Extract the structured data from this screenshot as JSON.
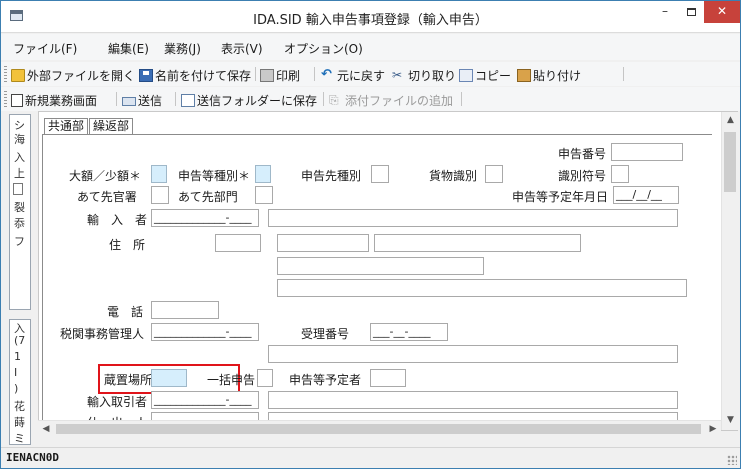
{
  "window": {
    "title": "IDA.SID 輸入申告事項登録（輸入申告）",
    "close_label": "✕",
    "minimize_label": "–"
  },
  "menu": {
    "items": [
      "ファイル(F)",
      "編集(E)",
      "業務(J)",
      "表示(V)",
      "オプション(O)"
    ]
  },
  "toolbar1": {
    "open_external": "外部ファイルを開く",
    "save_as": "名前を付けて保存",
    "print": "印刷",
    "undo": "元に戻す",
    "cut": "切り取り",
    "copy": "コピー",
    "paste": "貼り付け"
  },
  "toolbar2": {
    "new_screen": "新規業務画面",
    "send": "送信",
    "save_to_send_folder": "送信フォルダーに保存",
    "add_attachment": "添付ファイルの追加"
  },
  "left_panel": {
    "chars_top": [
      "シ",
      "海",
      "入",
      "上",
      "裂",
      "忝",
      "フ"
    ],
    "chars_bottom": [
      "入",
      "(7",
      "1",
      "I",
      ")",
      "花",
      "蒔",
      "ミ"
    ]
  },
  "tabs": [
    "共通部",
    "繰返部"
  ],
  "form": {
    "labels": {
      "declaration_no": "申告番号",
      "category": "大額／少額＊",
      "declaration_type": "申告等種別＊",
      "destination_type": "申告先種別",
      "cargo_id": "貨物識別",
      "id_mark": "識別符号",
      "office": "あて先官署",
      "department": "あて先部門",
      "planned_date": "申告等予定年月日",
      "importer": "輸　入　者",
      "address": "住　所",
      "phone": "電　話",
      "customs_agent": "税関事務管理人",
      "receipt_no": "受理番号",
      "storage_place": "蔵置場所＊",
      "bulk_declaration": "一括申告",
      "planned_declarant": "申告等予定者",
      "import_trader": "輸入取引者",
      "shipper": "仕　出　人"
    },
    "values": {
      "planned_date": "___/__/__",
      "importer_code": "_____________-____",
      "customs_agent_code": "_____________-____",
      "receipt_no": "___-__-____",
      "import_trader_code": "_____________-____",
      "shipper_code": "_______-"
    }
  },
  "status": {
    "text": "IENACN0D"
  },
  "colors": {
    "required_field": "#d6eefc",
    "highlight": "#e0141a",
    "close_button": "#c7423b"
  }
}
